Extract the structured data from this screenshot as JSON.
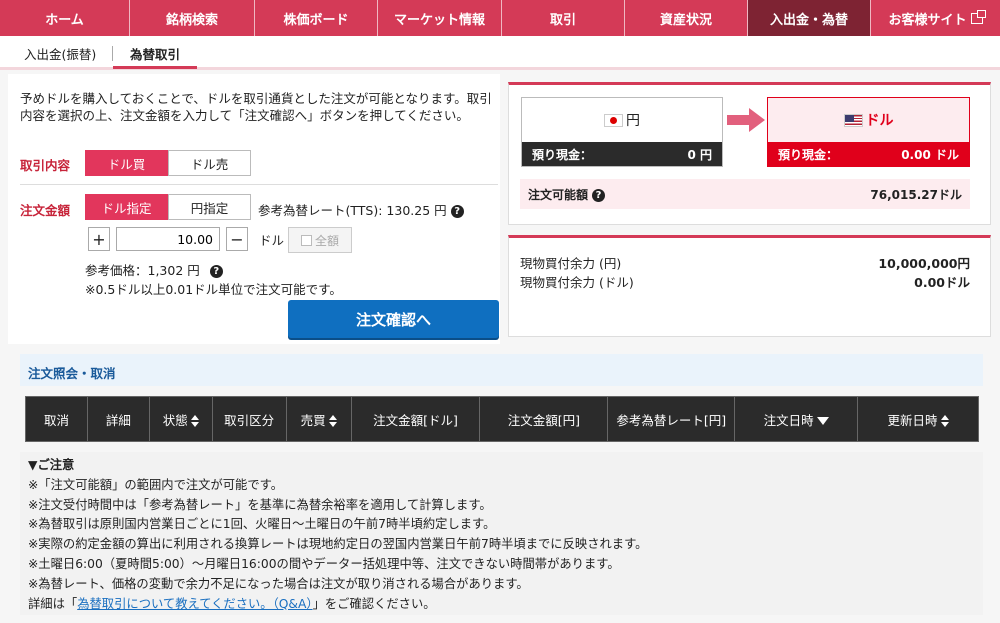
{
  "nav": {
    "items": [
      {
        "label": "ホーム"
      },
      {
        "label": "銘柄検索"
      },
      {
        "label": "株価ボード"
      },
      {
        "label": "マーケット情報"
      },
      {
        "label": "取引"
      },
      {
        "label": "資産状況"
      },
      {
        "label": "入出金・為替"
      },
      {
        "label": "お客様サイト"
      }
    ],
    "active_index": 6
  },
  "subtabs": [
    {
      "label": "入出金(振替)"
    },
    {
      "label": "為替取引"
    }
  ],
  "form": {
    "intro": "予めドルを購入しておくことで、ドルを取引通貨とした注文が可能となります。取引内容を選択の上、注文金額を入力して「注文確認へ」ボタンを押してください。",
    "trade_label": "取引内容",
    "trade_options": [
      "ドル買",
      "ドル売"
    ],
    "amount_label": "注文金額",
    "amount_options": [
      "ドル指定",
      "円指定"
    ],
    "rate_text": "参考為替レート(TTS): 130.25 円",
    "plus": "+",
    "minus": "−",
    "amount_value": "10.00",
    "unit": "ドル",
    "all_label": "全額",
    "ref_price": "参考価格：1,302 円",
    "note": "※0.5ドル以上0.01ドル単位で注文可能です。",
    "confirm_button": "注文確認へ"
  },
  "balance": {
    "yen_card": {
      "label": "円",
      "cash_label": "預り現金：",
      "cash_value": "0 円"
    },
    "usd_card": {
      "label": "ドル",
      "cash_label": "預り現金：",
      "cash_value": "0.00 ドル"
    },
    "available_label": "注文可能額",
    "available_value": "76,015.27ドル",
    "buying_power": [
      {
        "label": "現物買付余力 (円)",
        "value": "10,000,000円"
      },
      {
        "label": "現物買付余力 (ドル)",
        "value": "0.00ドル"
      }
    ]
  },
  "orders": {
    "title": "注文照会・取消",
    "columns": [
      "取消",
      "詳細",
      "状態",
      "取引区分",
      "売買",
      "注文金額[ドル]",
      "注文金額[円]",
      "参考為替レート[円]",
      "注文日時",
      "更新日時"
    ]
  },
  "notes": {
    "title": "▼ご注意",
    "lines": [
      "※「注文可能額」の範囲内で注文が可能です。",
      "※注文受付時間中は「参考為替レート」を基準に為替余裕率を適用して計算します。",
      "※為替取引は原則国内営業日ごとに1回、火曜日～土曜日の午前7時半頃約定します。",
      "※実際の約定金額の算出に利用される換算レートは現地約定日の翌国内営業日午前7時半頃までに反映されます。",
      "※土曜日6:00（夏時間5:00）～月曜日16:00の間やデーター括処理中等、注文できない時間帯があります。",
      "※為替レート、価格の変動で余力不足になった場合は注文が取り消される場合があります。"
    ],
    "detail_prefix": "詳細は「",
    "detail_link": "為替取引について教えてください。（Q&A）",
    "detail_suffix": "」をご確認ください。"
  },
  "colors": {
    "accent": "#d43a57",
    "nav_active": "#7e2333",
    "button_blue": "#0f6fc0",
    "usd_red": "#e0001b"
  }
}
